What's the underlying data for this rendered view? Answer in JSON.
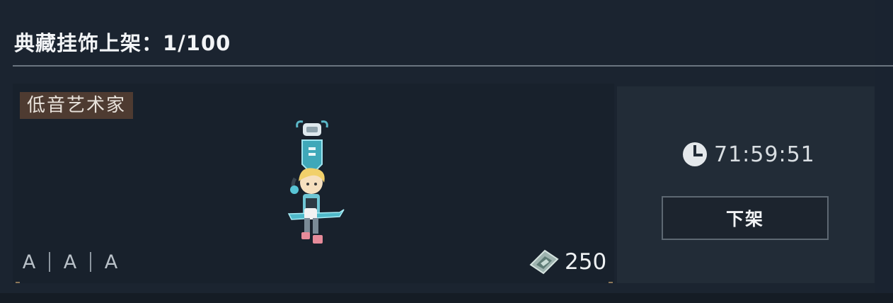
{
  "header": {
    "title": "典藏挂饰上架：1/100"
  },
  "item": {
    "name": "低音艺术家",
    "icon": "bassist-charm-icon",
    "tiers": [
      "A",
      "A",
      "A"
    ],
    "price": "250",
    "currency_icon": "gem-ticket-icon"
  },
  "listing": {
    "timer": "71:59:51",
    "timer_icon": "clock-icon",
    "unlist_label": "下架"
  },
  "colors": {
    "background": "#1b2430",
    "name_tag": "#4e3b31",
    "side_panel": "#222c37"
  }
}
